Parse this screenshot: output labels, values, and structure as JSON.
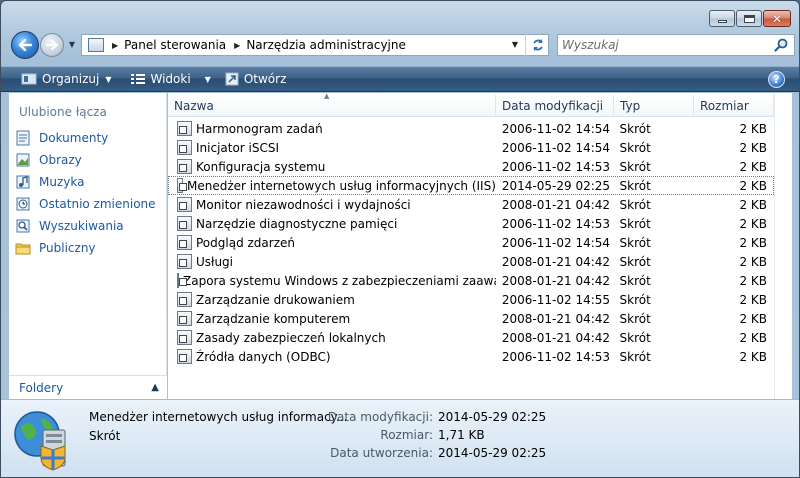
{
  "window": {
    "caption_buttons": [
      "minimize",
      "maximize",
      "close"
    ]
  },
  "address": {
    "crumbs": [
      "Panel sterowania",
      "Narzędzia administracyjne"
    ]
  },
  "search": {
    "placeholder": "Wyszukaj"
  },
  "toolbar": {
    "organize_label": "Organizuj",
    "views_label": "Widoki",
    "open_label": "Otwórz"
  },
  "sidebar": {
    "header": "Ulubione łącza",
    "items": [
      {
        "label": "Dokumenty",
        "icon": "documents-icon"
      },
      {
        "label": "Obrazy",
        "icon": "pictures-icon"
      },
      {
        "label": "Muzyka",
        "icon": "music-icon"
      },
      {
        "label": "Ostatnio zmienione",
        "icon": "recent-icon"
      },
      {
        "label": "Wyszukiwania",
        "icon": "searches-icon"
      },
      {
        "label": "Publiczny",
        "icon": "public-folder-icon"
      }
    ],
    "folders_label": "Foldery"
  },
  "filelist": {
    "columns": [
      "Nazwa",
      "Data modyfikacji",
      "Typ",
      "Rozmiar"
    ],
    "rows": [
      {
        "name": "Harmonogram zadań",
        "date": "2006-11-02 14:54",
        "type": "Skrót",
        "size": "2 KB"
      },
      {
        "name": "Inicjator iSCSI",
        "date": "2006-11-02 14:54",
        "type": "Skrót",
        "size": "2 KB"
      },
      {
        "name": "Konfiguracja systemu",
        "date": "2006-11-02 14:53",
        "type": "Skrót",
        "size": "2 KB"
      },
      {
        "name": "Menedżer internetowych usług informacyjnych (IIS)",
        "date": "2014-05-29 02:25",
        "type": "Skrót",
        "size": "2 KB"
      },
      {
        "name": "Monitor niezawodności i wydajności",
        "date": "2008-01-21 04:42",
        "type": "Skrót",
        "size": "2 KB"
      },
      {
        "name": "Narzędzie diagnostyczne pamięci",
        "date": "2006-11-02 14:53",
        "type": "Skrót",
        "size": "2 KB"
      },
      {
        "name": "Podgląd zdarzeń",
        "date": "2006-11-02 14:54",
        "type": "Skrót",
        "size": "2 KB"
      },
      {
        "name": "Usługi",
        "date": "2008-01-21 04:42",
        "type": "Skrót",
        "size": "2 KB"
      },
      {
        "name": "Zapora systemu Windows z zabezpieczeniami zaawans...",
        "date": "2008-01-21 04:42",
        "type": "Skrót",
        "size": "2 KB"
      },
      {
        "name": "Zarządzanie drukowaniem",
        "date": "2006-11-02 14:55",
        "type": "Skrót",
        "size": "2 KB"
      },
      {
        "name": "Zarządzanie komputerem",
        "date": "2008-01-21 04:42",
        "type": "Skrót",
        "size": "2 KB"
      },
      {
        "name": "Zasady zabezpieczeń lokalnych",
        "date": "2008-01-21 04:42",
        "type": "Skrót",
        "size": "2 KB"
      },
      {
        "name": "Źródła danych (ODBC)",
        "date": "2006-11-02 14:53",
        "type": "Skrót",
        "size": "2 KB"
      }
    ],
    "selected_index": 3
  },
  "details": {
    "title": "Menedżer internetowych usług informacy...",
    "type": "Skrót",
    "props": [
      {
        "key": "Data modyfikacji:",
        "value": "2014-05-29 02:25"
      },
      {
        "key": "Rozmiar:",
        "value": "1,71 KB"
      },
      {
        "key": "Data utworzenia:",
        "value": "2014-05-29 02:25"
      }
    ]
  },
  "colors": {
    "toolbar": "#355c82",
    "link": "#1b59a6",
    "header_text": "#1e395b"
  }
}
